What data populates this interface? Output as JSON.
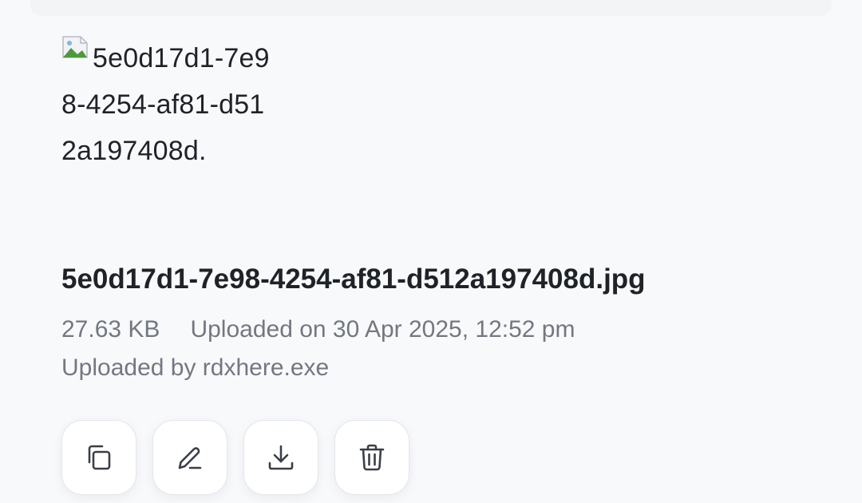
{
  "image": {
    "alt_text": "5e0d17d1-7e98-4254-af81-d512a197408d.",
    "icon": "broken-image-icon"
  },
  "file": {
    "name": "5e0d17d1-7e98-4254-af81-d512a197408d.jpg",
    "size": "27.63 KB",
    "uploaded_on": "Uploaded on 30 Apr 2025, 12:52 pm",
    "uploaded_by": "Uploaded by rdxhere.exe"
  },
  "actions": [
    {
      "name": "copy",
      "icon": "copy-icon"
    },
    {
      "name": "edit",
      "icon": "pencil-icon"
    },
    {
      "name": "download",
      "icon": "download-icon"
    },
    {
      "name": "delete",
      "icon": "trash-icon"
    }
  ],
  "colors": {
    "background": "#f8f9fb",
    "text_primary": "#1f2328",
    "text_secondary": "#737780",
    "button_border": "#e3e6ec"
  }
}
